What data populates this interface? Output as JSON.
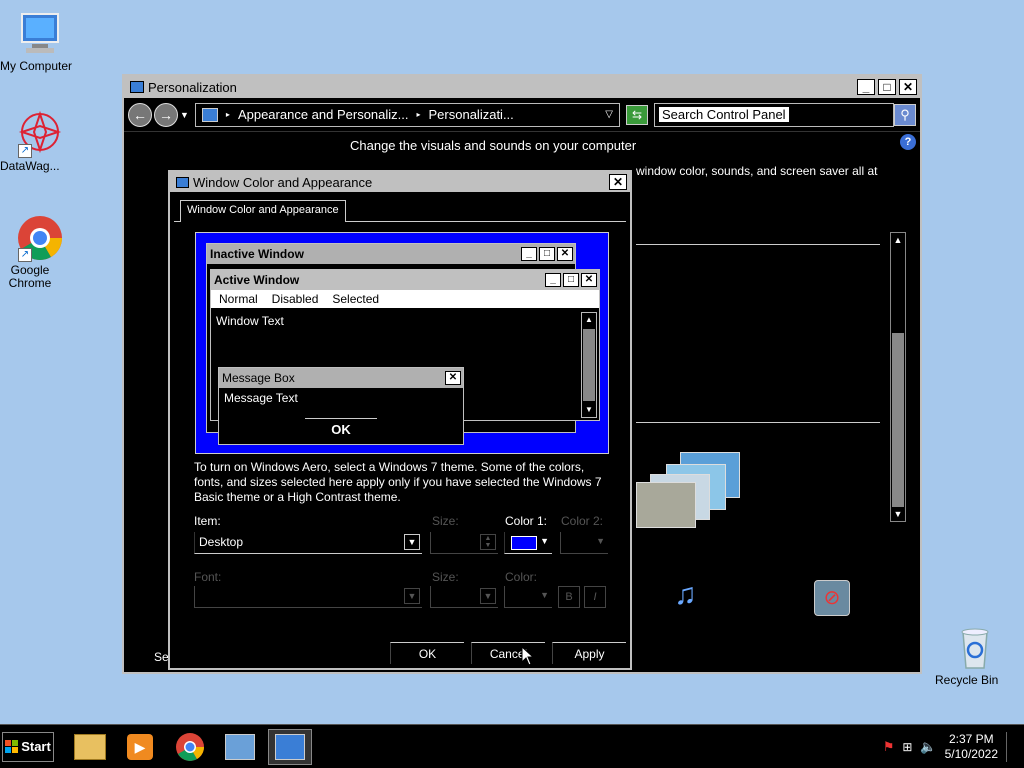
{
  "desktop": {
    "icons": [
      {
        "label": "My Computer"
      },
      {
        "label": "DataWag..."
      },
      {
        "label": "Google Chrome"
      },
      {
        "label": "Recycle Bin"
      }
    ]
  },
  "window": {
    "title": "Personalization",
    "breadcrumb": [
      "Appearance and Personaliz...",
      "Personalizati..."
    ],
    "search_placeholder": "Search Control Panel",
    "heading": "Change the visuals and sounds on your computer",
    "subheading": "window color, sounds, and screen saver all at",
    "left_cut": "Se"
  },
  "dialog": {
    "title": "Window Color and Appearance",
    "tab": "Window Color and Appearance",
    "preview": {
      "inactive_title": "Inactive Window",
      "active_title": "Active Window",
      "menu": [
        "Normal",
        "Disabled",
        "Selected"
      ],
      "window_text": "Window Text",
      "msgbox_title": "Message Box",
      "msgbox_text": "Message Text",
      "ok": "OK"
    },
    "info": "To turn on Windows Aero, select a Windows 7 theme.  Some of the colors, fonts, and sizes selected here apply only if you have selected the Windows 7 Basic theme or a High Contrast theme.",
    "item_label": "Item:",
    "item_value": "Desktop",
    "size_label": "Size:",
    "color1_label": "Color 1:",
    "color1_value": "#0000ff",
    "color2_label": "Color 2:",
    "font_label": "Font:",
    "size2_label": "Size:",
    "color_label": "Color:",
    "bold_label": "B",
    "italic_label": "I",
    "buttons": {
      "ok": "OK",
      "cancel": "Cancel",
      "apply": "Apply"
    }
  },
  "taskbar": {
    "start": "Start",
    "time": "2:37 PM",
    "date": "5/10/2022"
  },
  "colors": {
    "desktop": "#a6c8ec",
    "highlight_blue": "#0000ff",
    "chrome": "#c0c0c0"
  }
}
